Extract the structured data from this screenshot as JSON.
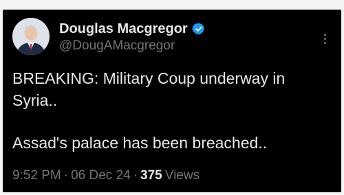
{
  "author": {
    "name": "Douglas Macgregor",
    "handle": "@DougAMacgregor",
    "verified_color": "#1d9bf0"
  },
  "tweet": {
    "lines": [
      "BREAKING: Military Coup underway in",
      "Syria..",
      "Assad's palace has been breached.."
    ]
  },
  "meta": {
    "time": "9:52 PM",
    "date": "06 Dec 24",
    "separator": "·",
    "views_count": "375",
    "views_label": "Views"
  },
  "icons": {
    "verified": "verified-badge-icon",
    "more": "more-options-icon"
  }
}
